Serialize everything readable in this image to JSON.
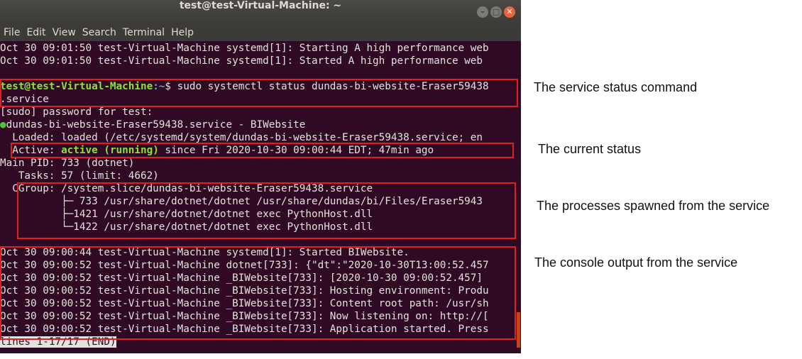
{
  "window": {
    "title": "test@test-Virtual-Machine: ~",
    "controls": {
      "minimize": "–",
      "maximize": "□",
      "close": "✕"
    }
  },
  "menu": [
    "File",
    "Edit",
    "View",
    "Search",
    "Terminal",
    "Help"
  ],
  "terminal": {
    "top_lines": [
      "Oct 30 09:01:50 test-Virtual-Machine systemd[1]: Starting A high performance web",
      "Oct 30 09:01:50 test-Virtual-Machine systemd[1]: Started A high performance web"
    ],
    "prompt": {
      "user_host": "test@test-Virtual-Machine",
      "path": ":~",
      "command": "$ sudo systemctl status dundas-bi-website-Eraser59438",
      "command_cont": ".service"
    },
    "sudo_prompt": "[sudo] password for test:",
    "service_header": "dundas-bi-website-Eraser59438.service - BIWebsite",
    "loaded": "  Loaded: loaded (/etc/systemd/system/dundas-bi-website-Eraser59438.service; en",
    "active": {
      "label": "  Active: ",
      "state": "active (running)",
      "since": " since Fri 2020-10-30 09:00:44 EDT; 47min ago"
    },
    "main_pid": "Main PID: 733 (dotnet)",
    "tasks": "   Tasks: 57 (limit: 4662)",
    "cgroup": "  CGroup: /system.slice/dundas-bi-website-Eraser59438.service",
    "processes": [
      "          ├─ 733 /usr/share/dotnet/dotnet /usr/share/dundas/bi/Files/Eraser5943",
      "          ├─1421 /usr/share/dotnet/dotnet exec PythonHost.dll",
      "          └─1422 /usr/share/dotnet/dotnet exec PythonHost.dll"
    ],
    "log_lines": [
      "Oct 30 09:00:44 test-Virtual-Machine systemd[1]: Started BIWebsite.",
      "Oct 30 09:00:52 test-Virtual-Machine dotnet[733]: {\"dt\":\"2020-10-30T13:00:52.457",
      "Oct 30 09:00:52 test-Virtual-Machine _BIWebsite[733]: [2020-10-30 09:00:52.457]",
      "Oct 30 09:00:52 test-Virtual-Machine _BIWebsite[733]: Hosting environment: Produ",
      "Oct 30 09:00:52 test-Virtual-Machine _BIWebsite[733]: Content root path: /usr/sh",
      "Oct 30 09:00:52 test-Virtual-Machine _BIWebsite[733]: Now listening on: http://[",
      "Oct 30 09:00:52 test-Virtual-Machine _BIWebsite[733]: Application started. Press"
    ],
    "pager_status": "lines 1-17/17 (END)"
  },
  "annotations": {
    "command": "The service status command",
    "status": "The current status",
    "processes": "The processes spawned from the service",
    "console": "The console output from the service"
  },
  "colors": {
    "terminal_bg": "#300a24",
    "prompt_green": "#8ae234",
    "prompt_blue": "#729fcf",
    "highlight_box": "#e02020",
    "close_button": "#e9653b"
  }
}
